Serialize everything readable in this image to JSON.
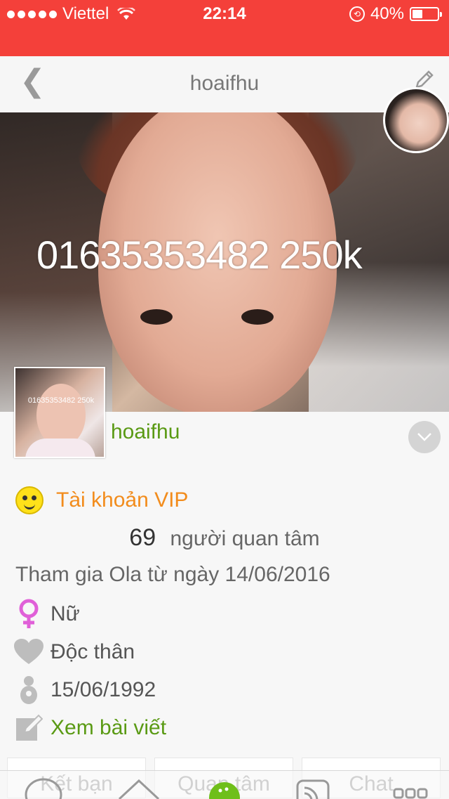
{
  "status_bar": {
    "carrier": "Viettel",
    "time": "22:14",
    "battery": "40%",
    "battery_level": 0.4
  },
  "nav": {
    "title": "hoaifhu"
  },
  "cover": {
    "caption": "01635353482 250k",
    "thumb_caption": "01635353482 250k"
  },
  "profile": {
    "username": "hoaifhu",
    "vip_label": "Tài khoản VIP",
    "followers_count": "69",
    "followers_label": "người quan tâm",
    "joined": "Tham gia Ola từ ngày 14/06/2016",
    "gender": "Nữ",
    "relationship": "Độc thân",
    "birthday": "15/06/1992",
    "posts_link": "Xem bài viết"
  },
  "actions": {
    "add_friend": "Kết bạn",
    "follow": "Quan tâm",
    "chat": "Chat"
  },
  "colors": {
    "status_bar": "#f4403a",
    "username": "#5a9a14",
    "vip": "#f28c1c",
    "gender_icon": "#e060d8"
  }
}
